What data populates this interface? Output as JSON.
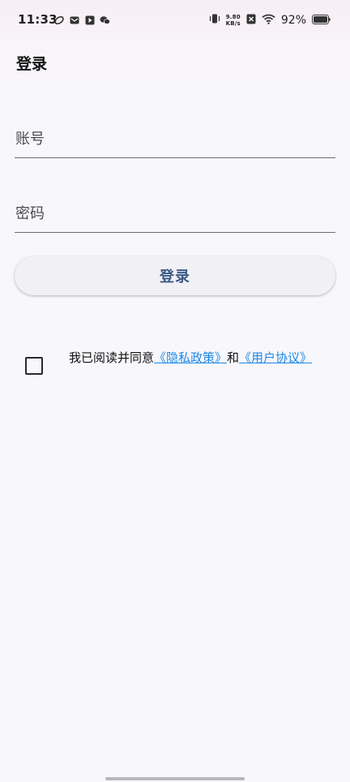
{
  "status_bar": {
    "time": "11:33",
    "net_speed_value": "9.80",
    "net_speed_unit": "KB/s",
    "battery_percent": "92%",
    "icons": [
      "leaf-app-icon",
      "mail-app-icon",
      "play-app-icon",
      "wechat-icon",
      "vibrate-icon",
      "sim-off-icon",
      "wifi-icon",
      "battery-icon"
    ]
  },
  "header": {
    "title": "登录"
  },
  "form": {
    "account_placeholder": "账号",
    "password_placeholder": "密码",
    "login_button_label": "登录"
  },
  "agreement": {
    "prefix": "我已阅读并同意",
    "privacy_link": "《隐私政策》",
    "conjunction": "和",
    "terms_link": "《用户协议》",
    "checked": false
  },
  "colors": {
    "button_text": "#3b5a86",
    "link": "#1e88e5",
    "background": "#f8f8fc"
  }
}
